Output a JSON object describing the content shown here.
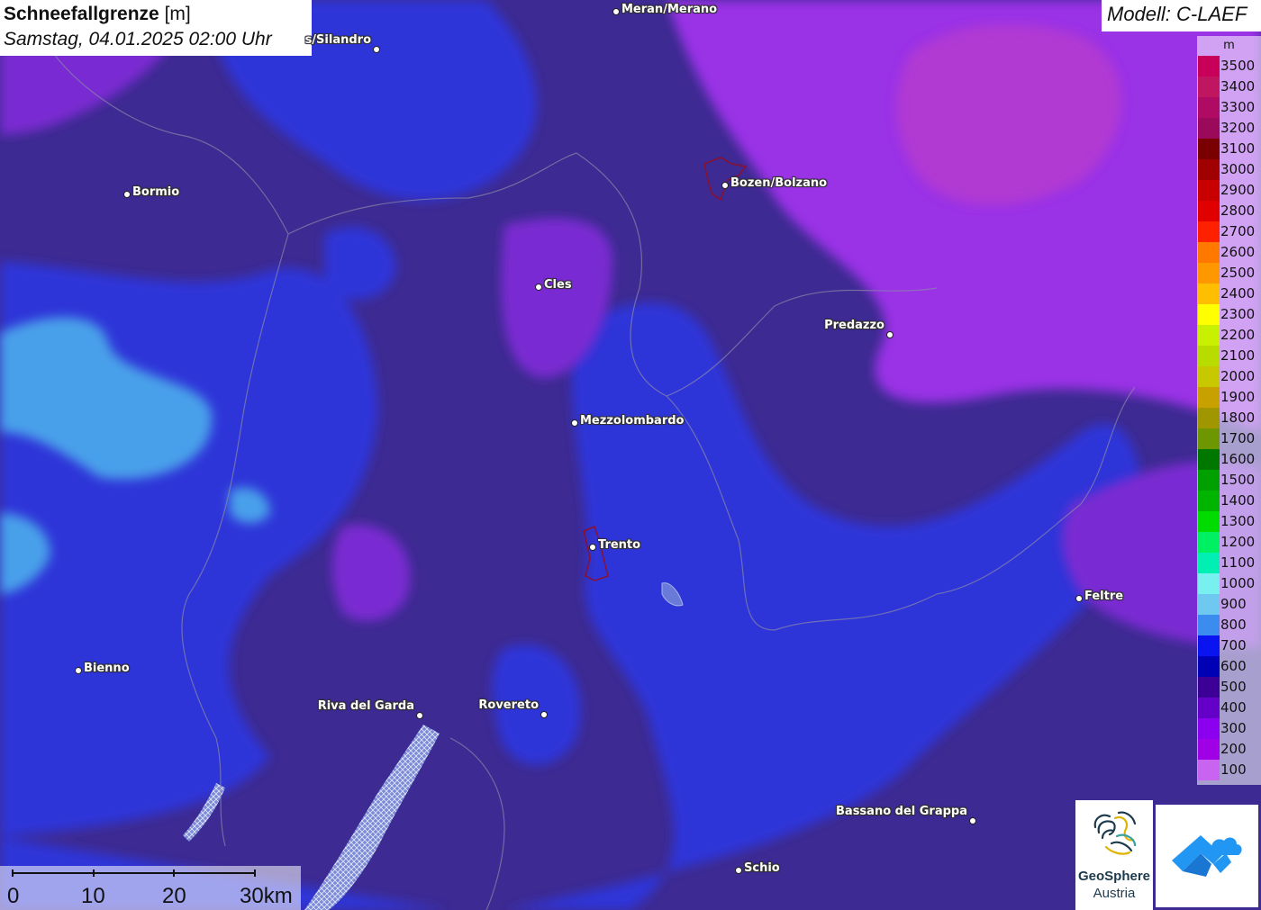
{
  "header": {
    "title_bold": "Schneefallgrenze",
    "title_unit": "[m]",
    "datetime": "Samstag, 04.01.2025 02:00 Uhr"
  },
  "model": {
    "label": "Modell: C-LAEF"
  },
  "legend": {
    "unit": "m",
    "items": [
      {
        "label": "3500",
        "color": "#c8005a"
      },
      {
        "label": "3400",
        "color": "#c01560"
      },
      {
        "label": "3300",
        "color": "#b00b64"
      },
      {
        "label": "3200",
        "color": "#9b0a5a"
      },
      {
        "label": "3100",
        "color": "#7a0000"
      },
      {
        "label": "3000",
        "color": "#a00000"
      },
      {
        "label": "2900",
        "color": "#c80000"
      },
      {
        "label": "2800",
        "color": "#e00000"
      },
      {
        "label": "2700",
        "color": "#ff2000"
      },
      {
        "label": "2600",
        "color": "#ff7800"
      },
      {
        "label": "2500",
        "color": "#ff9800"
      },
      {
        "label": "2400",
        "color": "#ffbe00"
      },
      {
        "label": "2300",
        "color": "#ffff00"
      },
      {
        "label": "2200",
        "color": "#c8f000"
      },
      {
        "label": "2100",
        "color": "#b8dc00"
      },
      {
        "label": "2000",
        "color": "#c8c800"
      },
      {
        "label": "1900",
        "color": "#c8a000"
      },
      {
        "label": "1800",
        "color": "#a09600"
      },
      {
        "label": "1700",
        "color": "#6e9600"
      },
      {
        "label": "1600",
        "color": "#007800"
      },
      {
        "label": "1500",
        "color": "#00a000"
      },
      {
        "label": "1400",
        "color": "#00b400"
      },
      {
        "label": "1300",
        "color": "#00dc00"
      },
      {
        "label": "1200",
        "color": "#00f064"
      },
      {
        "label": "1100",
        "color": "#00f0b4"
      },
      {
        "label": "1000",
        "color": "#78f0f0"
      },
      {
        "label": "900",
        "color": "#6ec8f0"
      },
      {
        "label": "800",
        "color": "#3c8cf0"
      },
      {
        "label": "700",
        "color": "#0a14f0"
      },
      {
        "label": "600",
        "color": "#0000b4"
      },
      {
        "label": "500",
        "color": "#3c0096"
      },
      {
        "label": "400",
        "color": "#6400c8"
      },
      {
        "label": "300",
        "color": "#8c00f0"
      },
      {
        "label": "200",
        "color": "#a000e6"
      },
      {
        "label": "100",
        "color": "#c864f0"
      }
    ]
  },
  "cities": [
    {
      "name": "Meran/Merano",
      "side": "right"
    },
    {
      "name": "s/Silandro",
      "side": "left"
    },
    {
      "name": "Bormio",
      "side": "right"
    },
    {
      "name": "Bozen/Bolzano",
      "side": "right"
    },
    {
      "name": "Cles",
      "side": "right"
    },
    {
      "name": "Predazzo",
      "side": "left"
    },
    {
      "name": "Mezzolombardo",
      "side": "right"
    },
    {
      "name": "Trento",
      "side": "right"
    },
    {
      "name": "Feltre",
      "side": "right"
    },
    {
      "name": "Bienno",
      "side": "right"
    },
    {
      "name": "Riva del Garda",
      "side": "left"
    },
    {
      "name": "Rovereto",
      "side": "left"
    },
    {
      "name": "Bassano del Grappa",
      "side": "left"
    },
    {
      "name": "Schio",
      "side": "right"
    }
  ],
  "scale": {
    "labels": [
      "0",
      "10",
      "20",
      "30km"
    ]
  },
  "logos": {
    "geo_line1": "GeoSphere",
    "geo_line2": "Austria"
  },
  "colors": {
    "base": "#3b2a8f",
    "blue": "#2e33d6",
    "light_blue": "#4a9ae8",
    "violet": "#6a28c8",
    "magenta": "#9a2ce0"
  }
}
